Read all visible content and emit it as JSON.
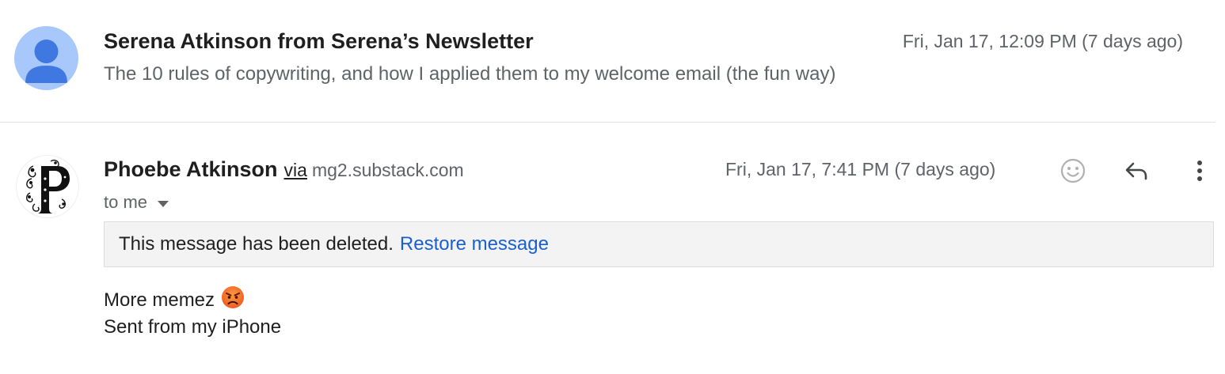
{
  "collapsed_message": {
    "sender": "Serena Atkinson from Serena’s Newsletter",
    "date": "Fri, Jan 17, 12:09 PM (7 days ago)",
    "snippet": "The 10 rules of copywriting, and how I applied them to my welcome email (the fun way)",
    "avatar_icon": "default-person-avatar-icon",
    "avatar_colors": {
      "background": "#a8c7fa",
      "figure": "#3f78e0"
    }
  },
  "open_message": {
    "sender": "Phoebe Atkinson",
    "via_label": "via",
    "via_domain": "mg2.substack.com",
    "date": "Fri, Jan 17, 7:41 PM (7 days ago)",
    "recipient": "to me",
    "avatar_icon": "ornate-letter-p-avatar-icon",
    "actions": [
      "add-reaction-icon",
      "reply-icon",
      "more-options-icon"
    ],
    "deleted_notice": "This message has been deleted.",
    "restore_label": "Restore message",
    "body_lines": [
      "More memez",
      "Sent from my iPhone"
    ],
    "body_emoji": "angry-face-emoji-icon"
  },
  "colors": {
    "link": "#1a5fd0",
    "secondary_text": "#5f6368",
    "banner_background": "#f3f3f3",
    "divider": "#e0e0e0"
  }
}
